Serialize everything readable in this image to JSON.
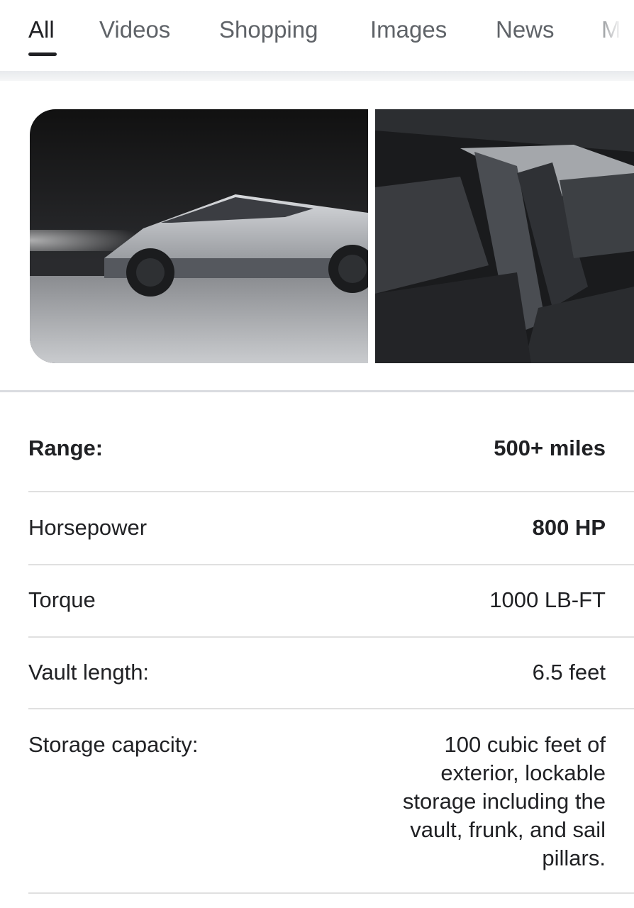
{
  "tabs": [
    {
      "label": "All",
      "active": true
    },
    {
      "label": "Videos",
      "active": false
    },
    {
      "label": "Shopping",
      "active": false
    },
    {
      "label": "Images",
      "active": false
    },
    {
      "label": "News",
      "active": false
    },
    {
      "label": "Ma",
      "active": false
    }
  ],
  "images": [
    {
      "name": "truck-exterior-image"
    },
    {
      "name": "truck-interior-image"
    }
  ],
  "specs": [
    {
      "label": "Range:",
      "value": "500+ miles"
    },
    {
      "label": "Horsepower",
      "value": "800 HP"
    },
    {
      "label": "Torque",
      "value": "1000 LB-FT"
    },
    {
      "label": "Vault length:",
      "value": "6.5 feet"
    },
    {
      "label": "Storage capacity:",
      "value_lines": [
        "100 cubic feet of",
        "exterior, lockable",
        "storage including the",
        "vault, frunk, and sail",
        "pillars."
      ]
    }
  ],
  "colors": {
    "text": "#202124",
    "tab_inactive": "#5f6368",
    "divider": "#e0e0e0"
  }
}
